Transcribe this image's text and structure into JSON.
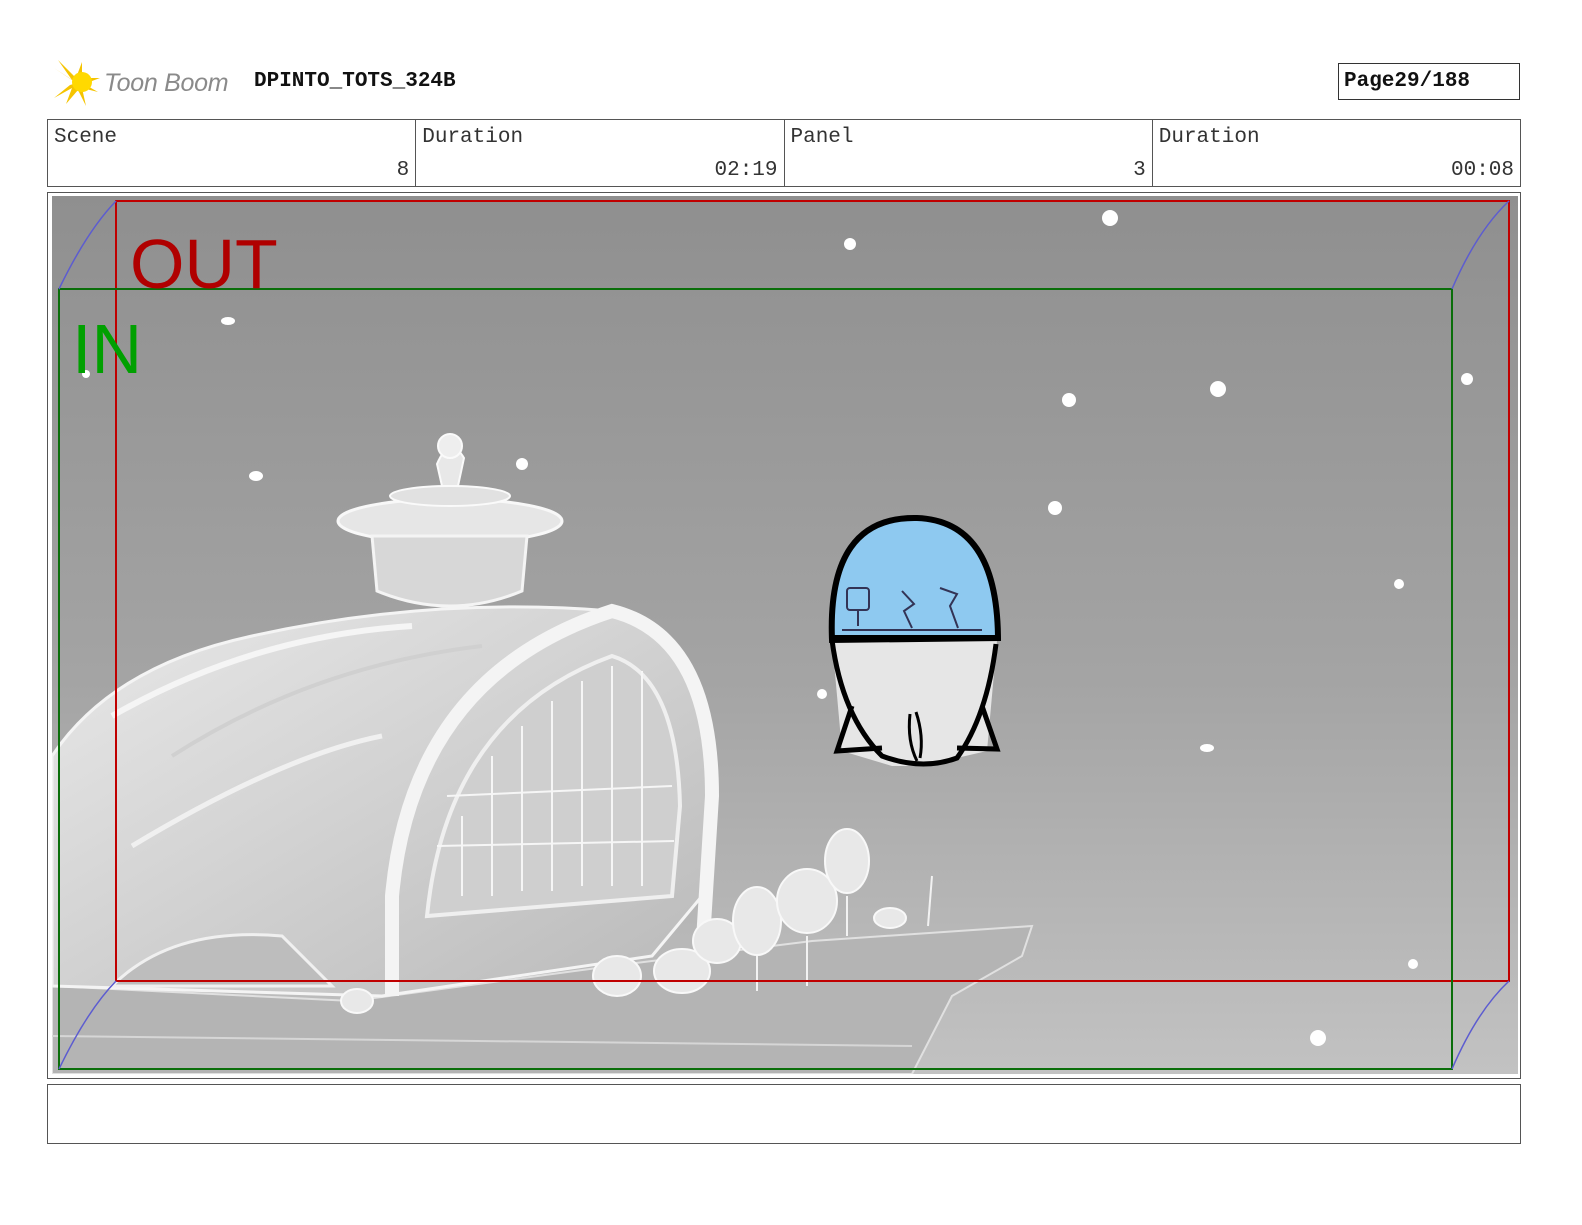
{
  "header": {
    "logo_text": "Toon Boom",
    "project": "DPINTO_TOTS_324B",
    "page_label": "Page",
    "page_value": "29/188"
  },
  "info": {
    "scene_label": "Scene",
    "scene_value": "8",
    "scene_duration_label": "Duration",
    "scene_duration_value": "02:19",
    "panel_label": "Panel",
    "panel_value": "3",
    "panel_duration_label": "Duration",
    "panel_duration_value": "00:08"
  },
  "panel": {
    "out_label": "OUT",
    "in_label": "IN",
    "out_color": "#b00000",
    "in_color": "#00a000",
    "pod_window_color": "#8ec9f0"
  },
  "caption": ""
}
